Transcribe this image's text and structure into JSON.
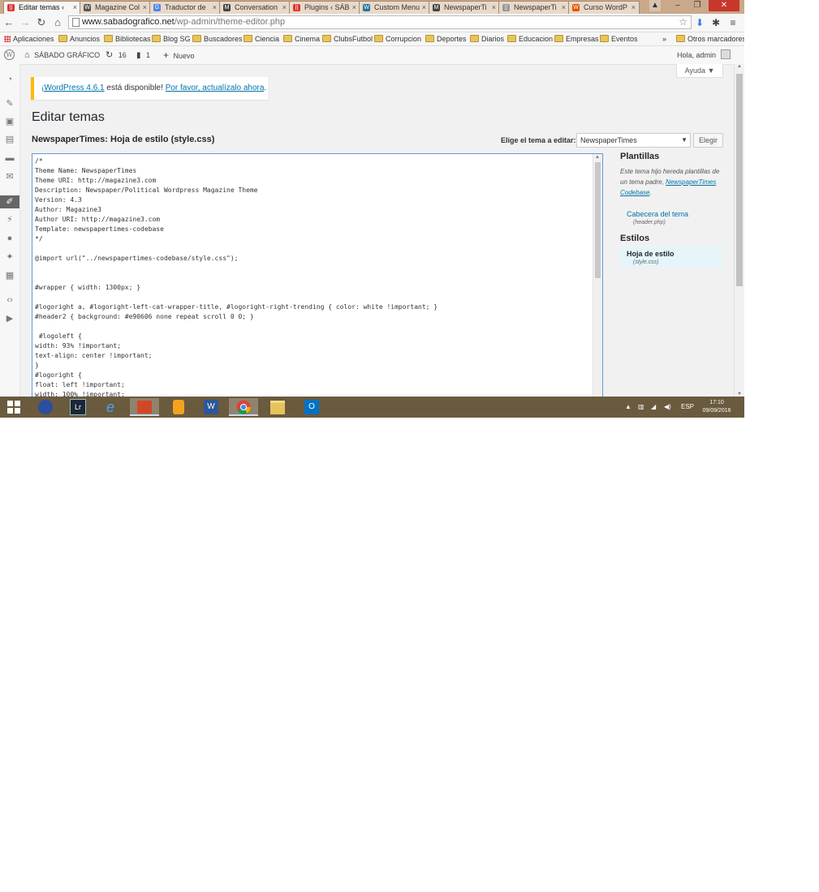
{
  "browser": {
    "tabs": [
      {
        "label": "Editar temas ‹",
        "icon": "||",
        "icon_color": "#d33",
        "active": true
      },
      {
        "label": "Magazine Col",
        "icon": "W",
        "icon_color": "#555",
        "active": false
      },
      {
        "label": "Traductor de",
        "icon": "G",
        "icon_color": "#4a86e8",
        "active": false
      },
      {
        "label": "Conversation",
        "icon": "M",
        "icon_color": "#444",
        "active": false
      },
      {
        "label": "Plugins ‹ SÁB",
        "icon": "||",
        "icon_color": "#d33",
        "active": false
      },
      {
        "label": "Custom Menu",
        "icon": "W",
        "icon_color": "#21759b",
        "active": false
      },
      {
        "label": "NewspaperTi",
        "icon": "M",
        "icon_color": "#444",
        "active": false
      },
      {
        "label": "NewspaperTi",
        "icon": "▯",
        "icon_color": "#999",
        "active": false
      },
      {
        "label": "Curso WordP",
        "icon": "W",
        "icon_color": "#e65100",
        "active": false
      }
    ],
    "url_host": "www.sabadografico.net",
    "url_path": "/wp-admin/theme-editor.php",
    "bookmarks": [
      "Aplicaciones",
      "Anuncios",
      "Bibliotecas",
      "Blog SG",
      "Buscadores",
      "Ciencia",
      "Cinema",
      "ClubsFutbol",
      "Corrupcion",
      "Deportes",
      "Diarios",
      "Educacion",
      "Empresas",
      "Eventos"
    ],
    "bookmarks_overflow": "»",
    "other_bookmarks": "Otros marcadores"
  },
  "adminbar": {
    "site_name": "SÁBADO GRÁFICO",
    "updates_count": "16",
    "comments_count": "1",
    "new_label": "Nuevo",
    "greeting": "Hola, admin"
  },
  "help_label": "Ayuda ▼",
  "notice": {
    "link1": "¡WordPress 4.6.1",
    "text": " está disponible! ",
    "link2": "Por favor, actualízalo ahora",
    "end": "."
  },
  "page_title": "Editar temas",
  "file_title": "NewspaperTimes: Hoja de estilo (style.css)",
  "theme_select": {
    "label": "Elige el tema a editar:",
    "value": "NewspaperTimes",
    "button": "Elegir"
  },
  "editor_code": "/*\nTheme Name: NewspaperTimes\nTheme URI: http://magazine3.com\nDescription: Newspaper/Political Wordpress Magazine Theme\nVersion: 4.3\nAuthor: Magazine3\nAuthor URI: http://magazine3.com\nTemplate: newspapertimes-codebase\n*/\n\n@import url(\"../newspapertimes-codebase/style.css\");\n\n\n#wrapper { width: 1300px; }\n\n#logoright a, #logoright-left-cat-wrapper-title, #logoright-right-trending { color: white !important; }\n#header2 { background: #e90606 none repeat scroll 0 0; }\n\n #logoleft {\nwidth: 93% !important;\ntext-align: center !important;\n}\n#logoright {\nfloat: left !important;\nwidth: 100% !important;",
  "sidebar": {
    "templates_heading": "Plantillas",
    "templates_desc": "Este tema hijo hereda plantillas de un tema padre, ",
    "parent_link": "NewspaperTimes Codebase",
    "templates_desc_end": ".",
    "template_files": [
      {
        "name": "Cabecera del tema",
        "path": "(header.php)"
      }
    ],
    "styles_heading": "Estilos",
    "style_files": [
      {
        "name": "Hoja de estilo",
        "path": "(style.css)"
      }
    ]
  },
  "taskbar": {
    "apps": [
      "windows-start",
      "browser-2",
      "lightroom",
      "internet-explorer",
      "app-red",
      "app-orange",
      "word",
      "chrome",
      "file-explorer",
      "outlook"
    ],
    "lightroom_label": "Lr",
    "word_label": "W",
    "outlook_label": "O",
    "language": "ESP",
    "time": "17:10",
    "date": "09/09/2016"
  },
  "colors": {
    "taskbar": "#6a5a3e",
    "link": "#0073aa",
    "notice_border": "#ffb900",
    "editor_border": "#5b9dd9"
  }
}
